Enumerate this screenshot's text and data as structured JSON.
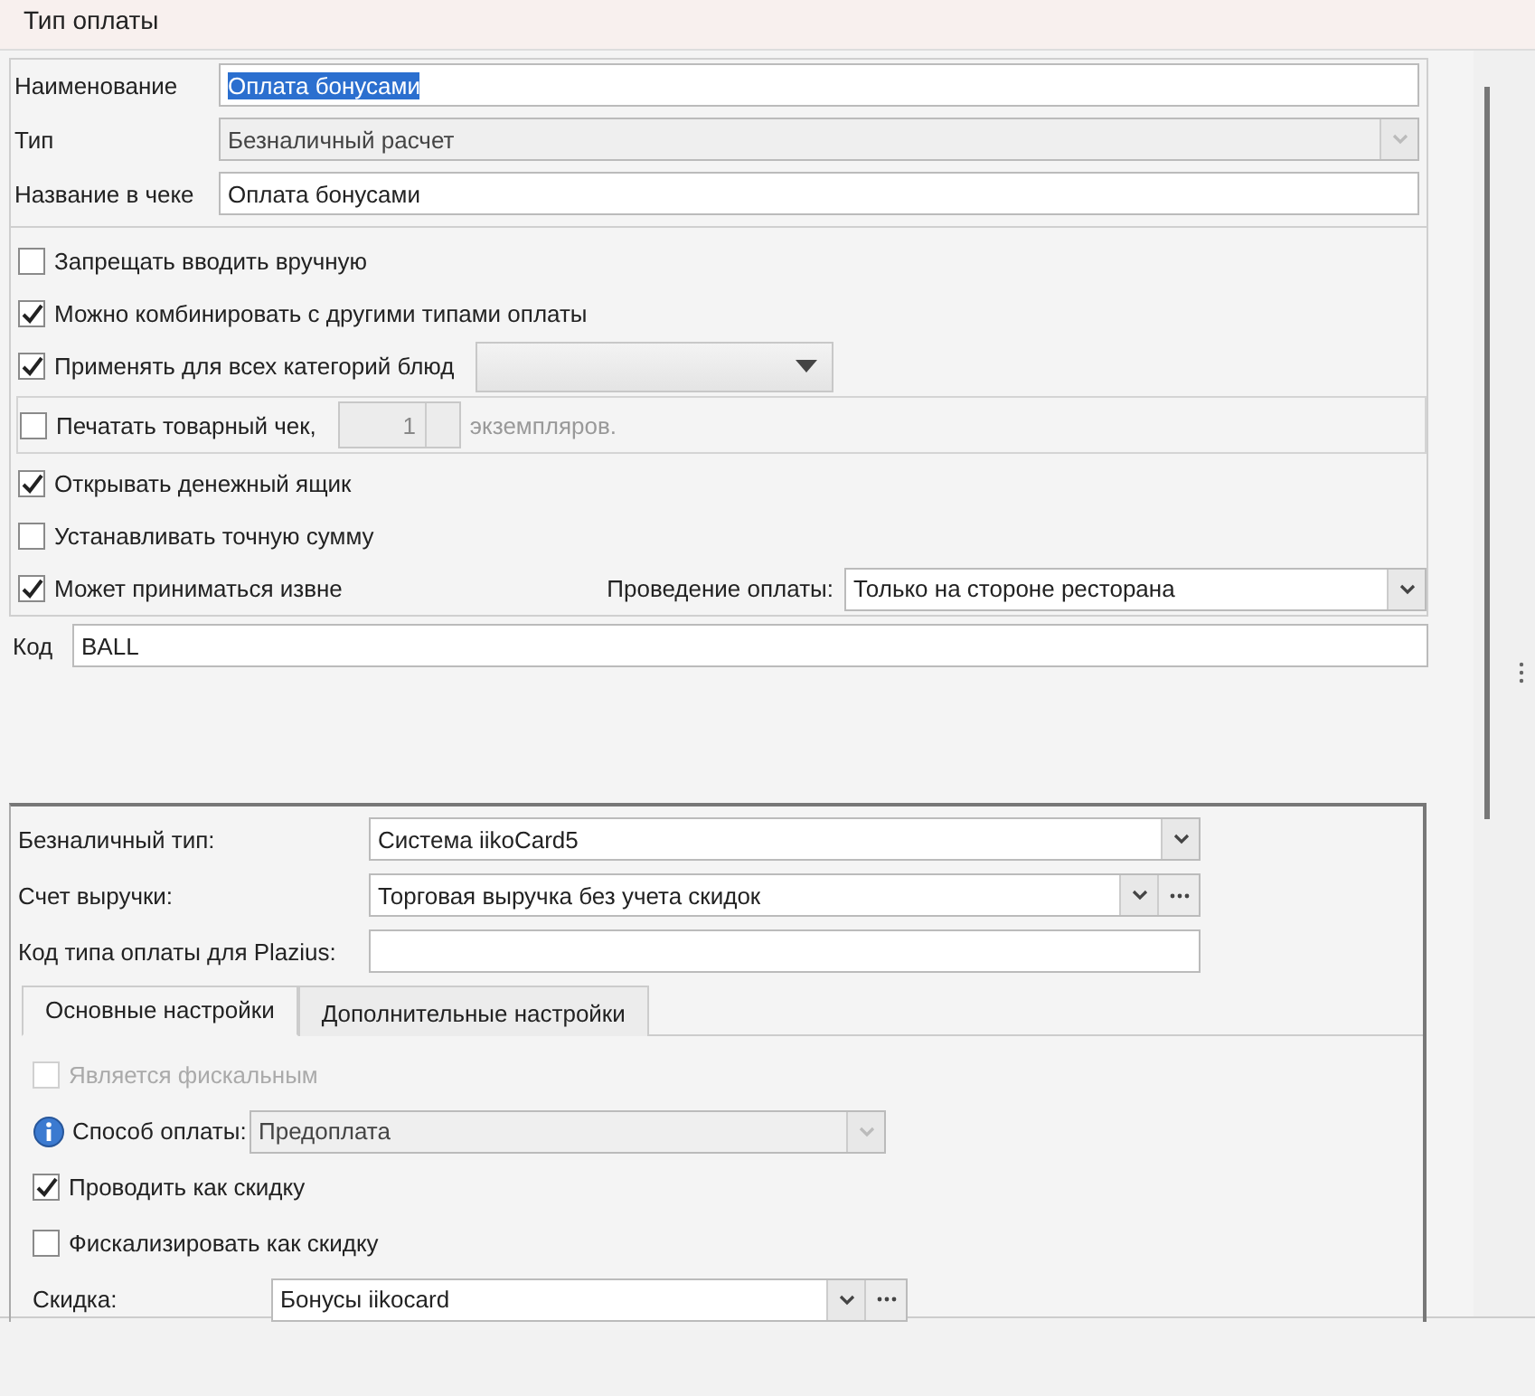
{
  "window": {
    "title": "Тип оплаты"
  },
  "main_fields": [
    {
      "label": "Наименование",
      "kind": "text",
      "value": "Оплата бонусами",
      "text_selected": true,
      "disabled": false
    },
    {
      "label": "Тип",
      "kind": "combo",
      "value": "Безналичный расчет",
      "disabled": true
    },
    {
      "label": "Название в чеке",
      "kind": "text",
      "value": "Оплата бонусами",
      "disabled": false
    }
  ],
  "options": [
    {
      "kind": "checkbox",
      "label": "Запрещать вводить вручную",
      "checked": false
    },
    {
      "kind": "checkbox",
      "label": "Можно комбинировать с другими типами оплаты",
      "checked": true
    },
    {
      "kind": "category_combo",
      "label": "Применять для всех категорий блюд",
      "checked": true
    },
    {
      "kind": "copies",
      "label": "Печатать товарный чек,",
      "checked": false,
      "copies": "1",
      "suffix": "экземпляров."
    },
    {
      "kind": "checkbox",
      "label": "Открывать денежный ящик",
      "checked": true
    },
    {
      "kind": "checkbox",
      "label": "Устанавливать точную сумму",
      "checked": false
    },
    {
      "kind": "processing",
      "label": "Может приниматься извне",
      "checked": true,
      "combo_label": "Проведение оплаты:",
      "combo_value": "Только на стороне ресторана"
    }
  ],
  "code": {
    "label": "Код",
    "value": "BALL"
  },
  "cashless_fields": [
    {
      "label": "Безналичный тип:",
      "kind": "combo",
      "value": "Система iikoCard5"
    },
    {
      "label": "Счет выручки:",
      "kind": "combo_browse",
      "value": "Торговая выручка без учета скидок"
    },
    {
      "label": "Код типа оплаты для Plazius:",
      "kind": "text"
    }
  ],
  "tabs": [
    {
      "label": "Основные настройки",
      "selected": true
    },
    {
      "label": "Дополнительные настройки",
      "selected": false
    }
  ],
  "tab_content": [
    {
      "kind": "checkbox",
      "label": "Является фискальным",
      "checked": false,
      "disabled": true
    },
    {
      "kind": "info_combo",
      "label": "Способ оплаты:",
      "value": "Предоплата",
      "disabled": true
    },
    {
      "kind": "checkbox",
      "label": "Проводить как скидку",
      "checked": true,
      "disabled": false
    },
    {
      "kind": "checkbox",
      "label": "Фискализировать как скидку",
      "checked": false,
      "disabled": false
    },
    {
      "kind": "combo_browse",
      "label": "Скидка:",
      "value": "Бонусы iikocard",
      "disabled": false
    }
  ]
}
